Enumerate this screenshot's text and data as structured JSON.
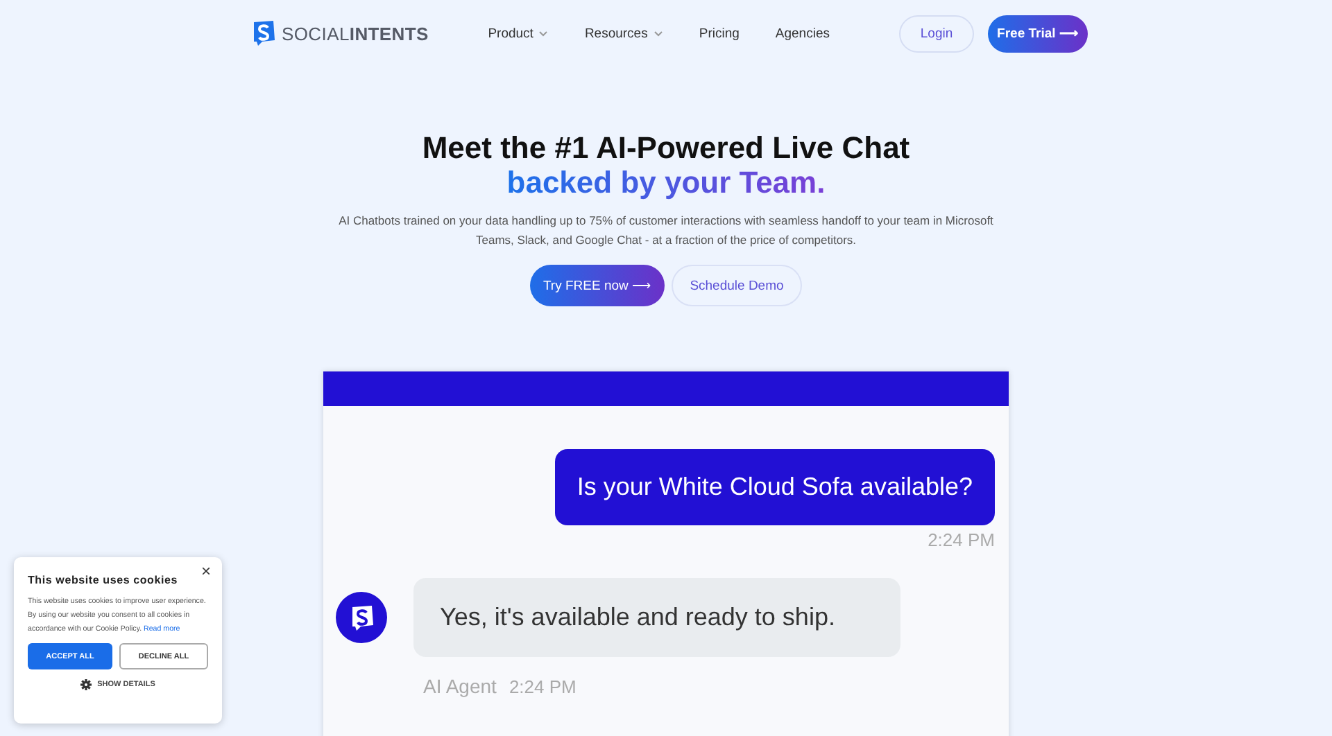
{
  "nav": {
    "logo": "SOCIAL**INTENTS**",
    "links": [
      {
        "label": "Product",
        "dropdown": true
      },
      {
        "label": "Resources",
        "dropdown": true
      },
      {
        "label": "Pricing",
        "dropdown": false
      },
      {
        "label": "Agencies",
        "dropdown": false
      }
    ],
    "login": "Login",
    "trial": "Free Trial ⟶"
  },
  "hero": {
    "title": "Meet the #1 AI-Powered Live Chat",
    "subtitle": "backed by your Team.",
    "description": "AI Chatbots trained on your data handling up to 75% of customer interactions with seamless handoff to your team in Microsoft Teams, Slack, and Google Chat - at a fraction of the price of competitors.",
    "primary": "Try FREE now ⟶",
    "secondary": "Schedule Demo"
  },
  "chat": {
    "messages": [
      {
        "kind": "user",
        "text": "Is your White Cloud Sofa available?",
        "time": "2:24 PM"
      },
      {
        "kind": "agent",
        "text": "Yes, it's available and ready to ship.",
        "sender": "AI Agent",
        "time": "2:24 PM"
      }
    ]
  },
  "cookies": {
    "close": "×",
    "title": "This website uses cookies",
    "body": "This website uses cookies to improve user experience. By using our website you consent to all cookies in accordance with our Cookie Policy.",
    "link": "Read more",
    "accept": "ACCEPT ALL",
    "decline": "DECLINE ALL",
    "details": "SHOW DETAILS"
  }
}
